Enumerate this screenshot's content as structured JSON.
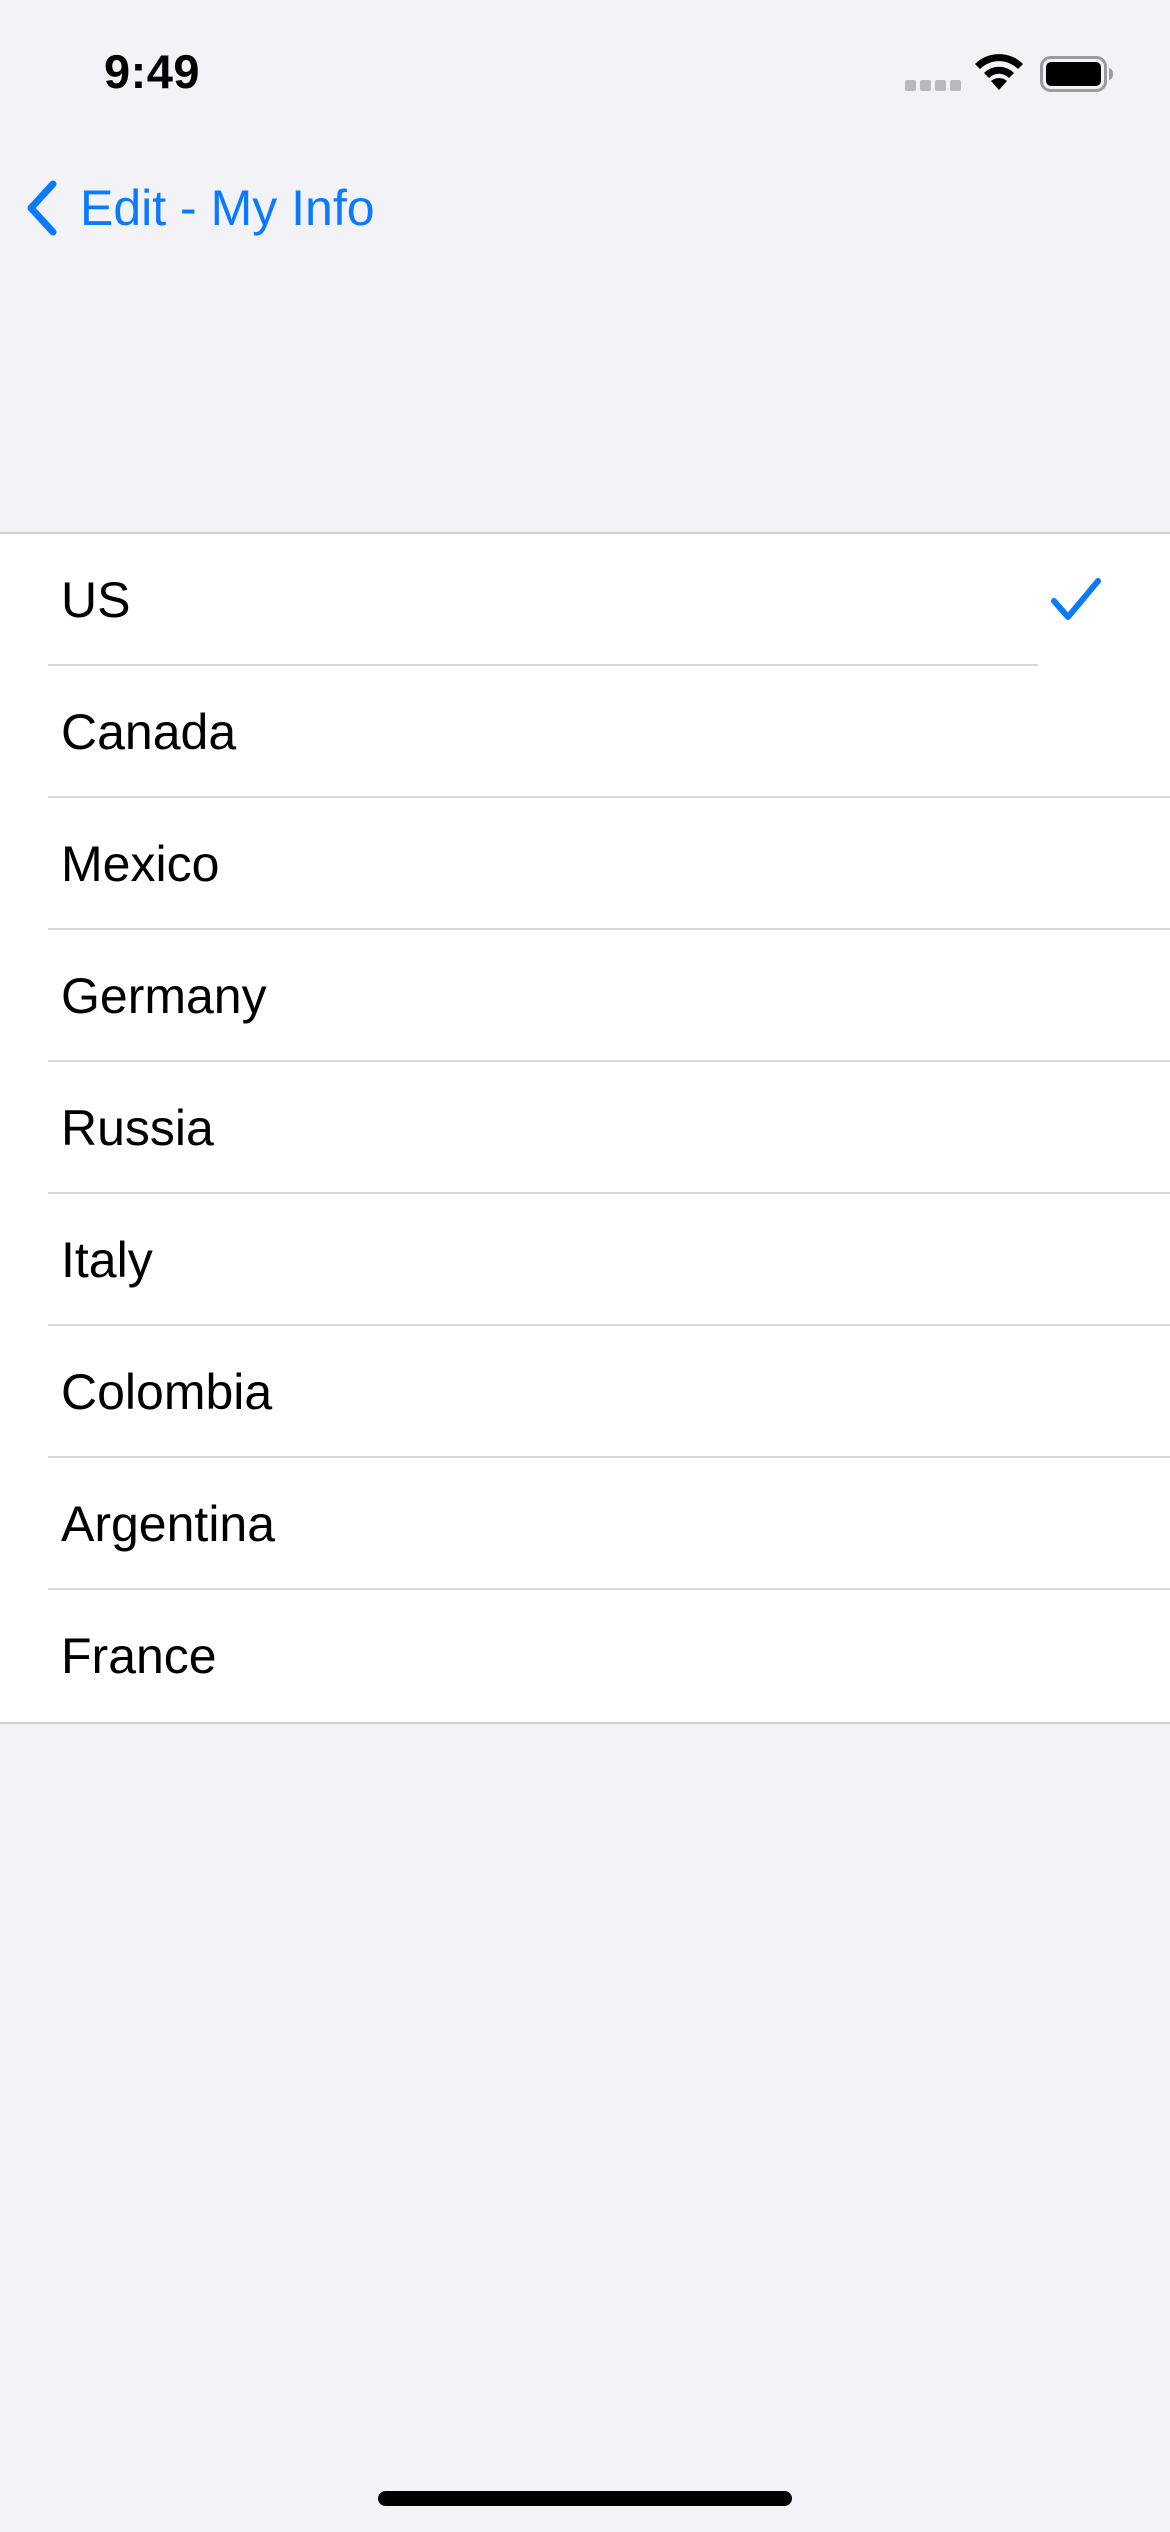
{
  "status_bar": {
    "time": "9:49"
  },
  "nav": {
    "back_label": "Edit - My Info",
    "back_icon": "chevron-left-icon"
  },
  "colors": {
    "accent": "#0a7aff",
    "background": "#f2f2f7",
    "cell_background": "#ffffff",
    "separator": "#d8d8dc"
  },
  "countries": {
    "selected": "US",
    "items": [
      {
        "label": "US",
        "selected": true
      },
      {
        "label": "Canada",
        "selected": false
      },
      {
        "label": "Mexico",
        "selected": false
      },
      {
        "label": "Germany",
        "selected": false
      },
      {
        "label": "Russia",
        "selected": false
      },
      {
        "label": "Italy",
        "selected": false
      },
      {
        "label": "Colombia",
        "selected": false
      },
      {
        "label": "Argentina",
        "selected": false
      },
      {
        "label": "France",
        "selected": false
      }
    ]
  }
}
